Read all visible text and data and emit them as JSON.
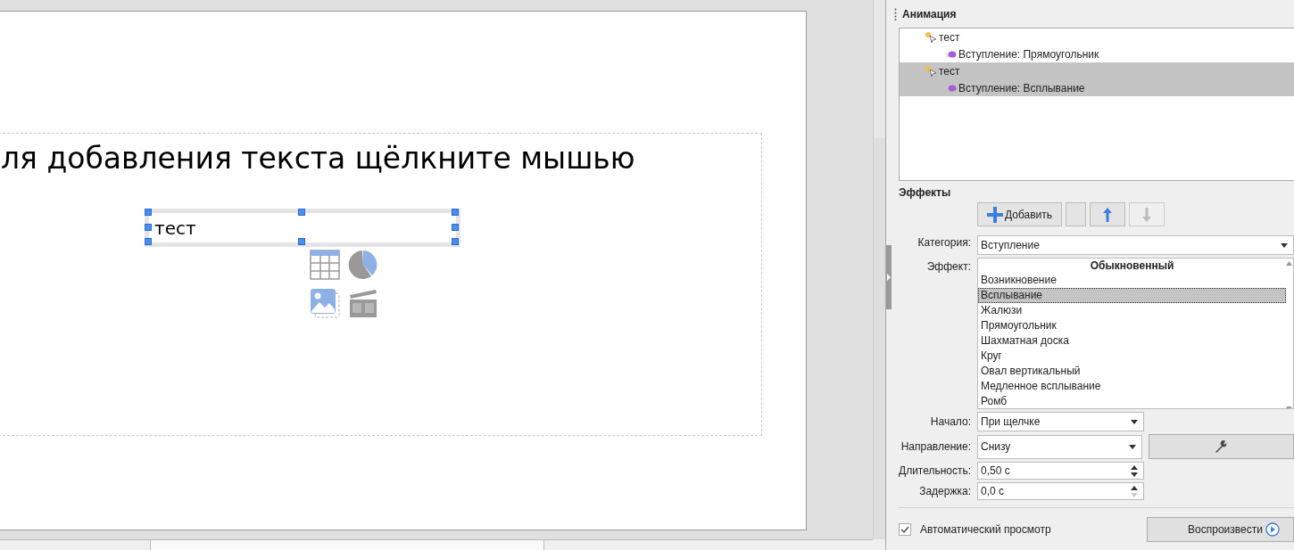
{
  "slide": {
    "title_placeholder": "ля добавления текста щёлкните мышью",
    "text_box": "тест",
    "text_box_selected": true
  },
  "animation": {
    "title": "Анимация",
    "items": [
      {
        "label": "тест",
        "selected": false,
        "children": [
          {
            "label": "Вступление: Прямоугольник"
          }
        ]
      },
      {
        "label": "тест",
        "selected": true,
        "children": [
          {
            "label": "Вступление: Всплывание"
          }
        ]
      }
    ]
  },
  "effects": {
    "title": "Эффекты",
    "buttons": [
      {
        "kind": "add",
        "label": "Добавить",
        "disabled": false
      },
      {
        "kind": "remove",
        "disabled": false
      },
      {
        "kind": "up",
        "disabled": false
      },
      {
        "kind": "down",
        "disabled": true
      }
    ],
    "category": {
      "label": "Категория:",
      "value": "Вступление"
    },
    "effect": {
      "label": "Эффект:",
      "group": "Обыкновенный",
      "items": [
        {
          "label": "Возникновение",
          "selected": false
        },
        {
          "label": "Всплывание",
          "selected": true
        },
        {
          "label": "Жалюзи",
          "selected": false
        },
        {
          "label": "Прямоугольник",
          "selected": false
        },
        {
          "label": "Шахматная доска",
          "selected": false
        },
        {
          "label": "Круг",
          "selected": false
        },
        {
          "label": "Овал вертикальный",
          "selected": false
        },
        {
          "label": "Медленное всплывание",
          "selected": false
        },
        {
          "label": "Ромб",
          "selected": false
        }
      ]
    },
    "start": {
      "label": "Начало:",
      "value": "При щелчке"
    },
    "direction": {
      "label": "Направление:",
      "value": "Снизу"
    },
    "duration": {
      "label": "Длительность:",
      "value": "0,50 с"
    },
    "delay": {
      "label": "Задержка:",
      "value": "0,0 с",
      "down_disabled": true
    },
    "autopreview": {
      "label": "Автоматический просмотр",
      "checked": true
    },
    "play": {
      "label": "Воспроизвести"
    }
  }
}
